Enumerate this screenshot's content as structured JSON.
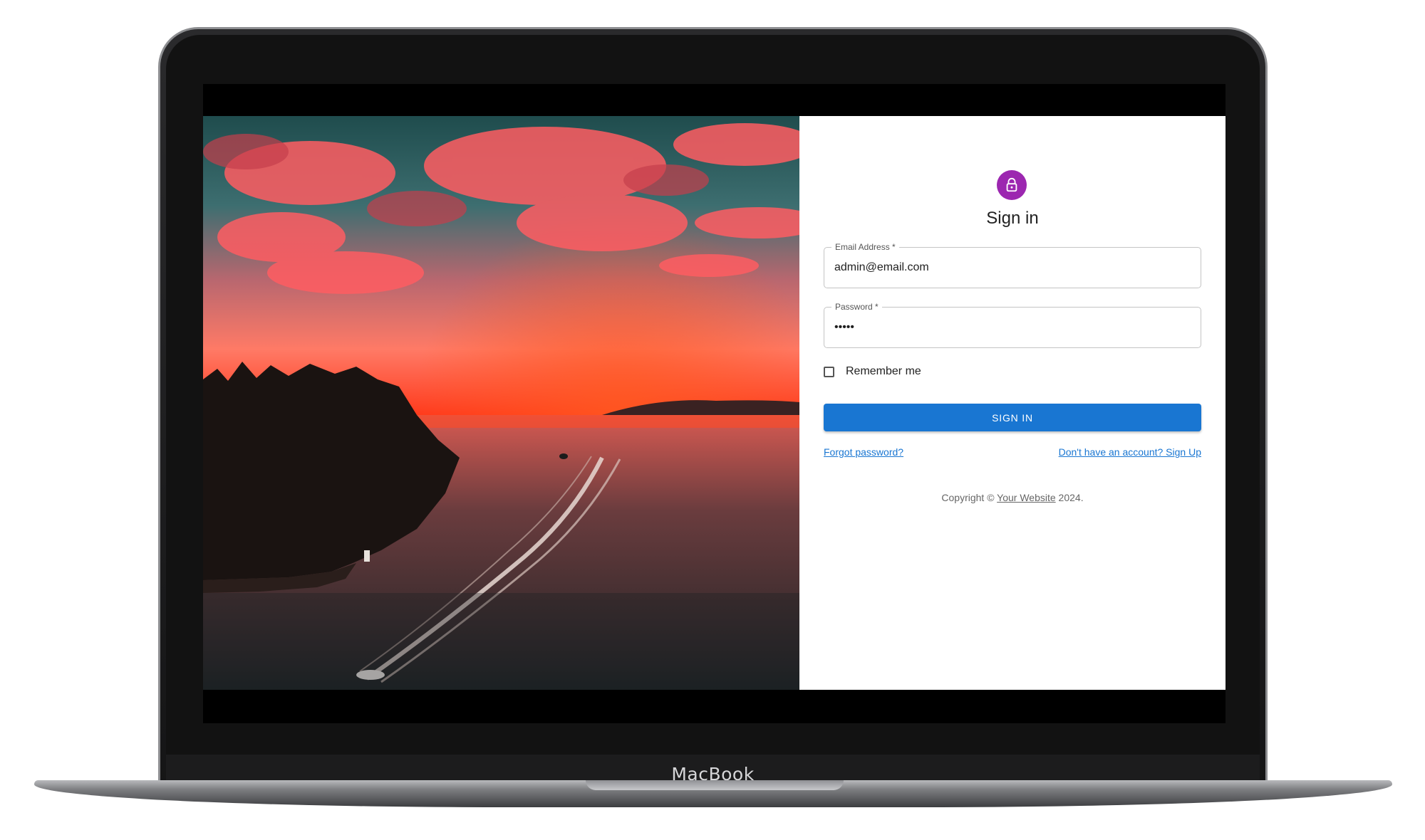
{
  "device": {
    "brand": "MacBook"
  },
  "login": {
    "title": "Sign in",
    "email": {
      "label": "Email Address *",
      "value": "admin@email.com"
    },
    "password": {
      "label": "Password *",
      "value": "•••••"
    },
    "remember_label": "Remember me",
    "submit_label": "SIGN IN",
    "forgot_link": "Forgot password?",
    "signup_link": "Don't have an account? Sign Up",
    "copyright": {
      "prefix": "Copyright © ",
      "site": "Your Website",
      "suffix": " 2024."
    }
  },
  "icons": {
    "avatar": "lock-icon"
  },
  "colors": {
    "avatar_bg": "#9c27b0",
    "primary": "#1976d2",
    "panel_bg": "#ffffff"
  }
}
